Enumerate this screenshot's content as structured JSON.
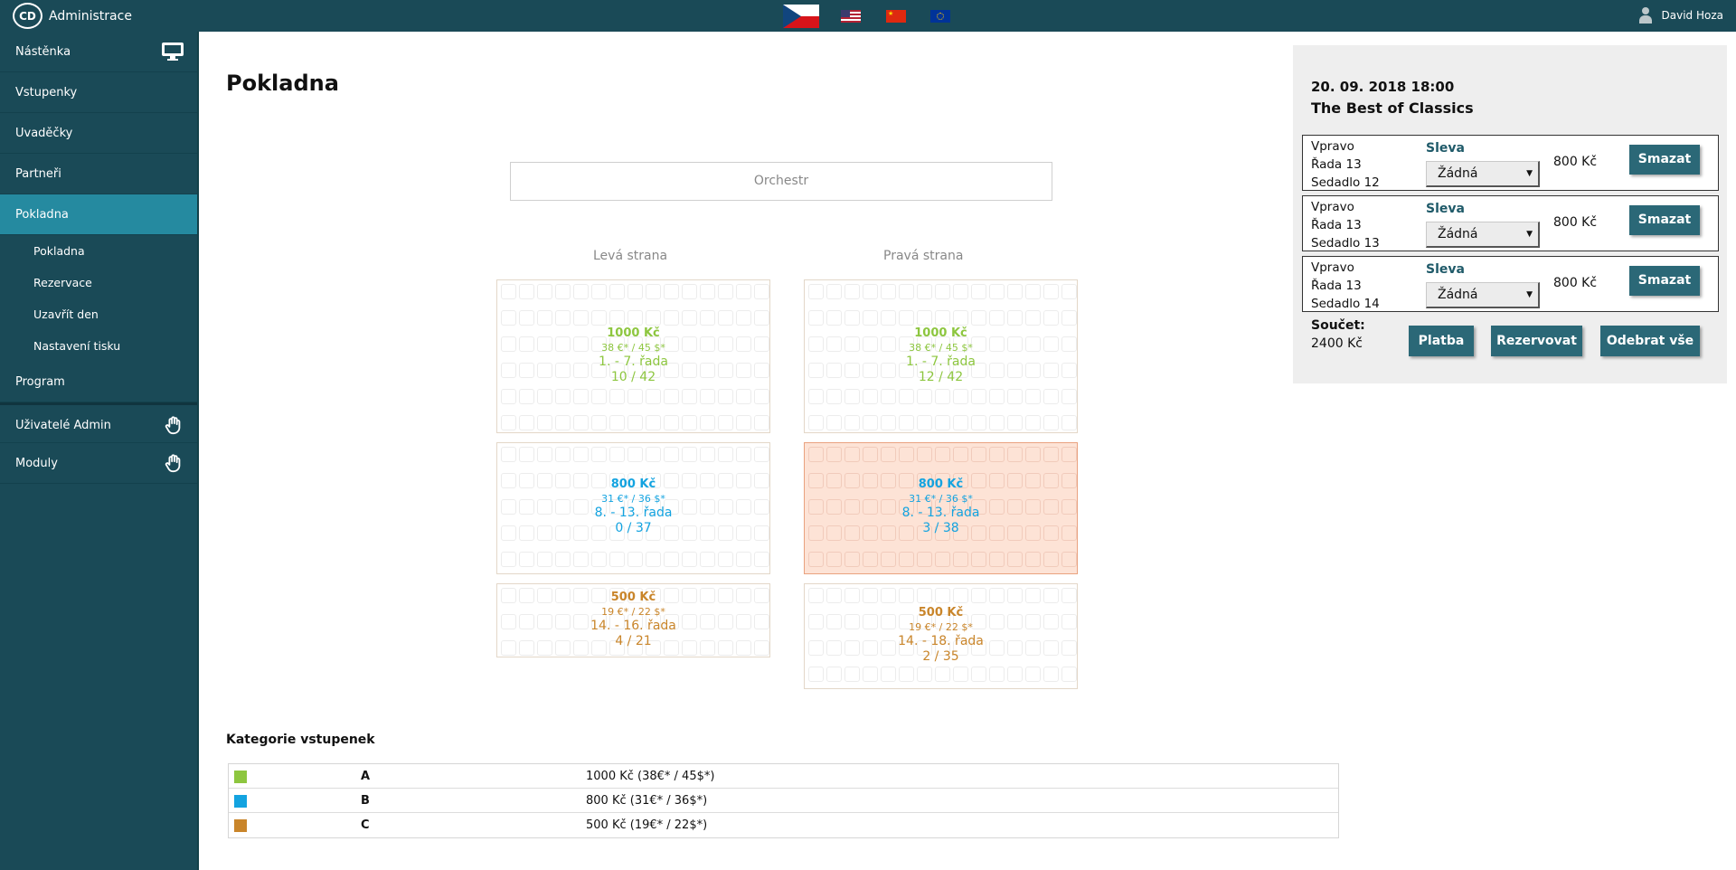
{
  "header": {
    "logo_text": "CD",
    "app_title": "Administrace",
    "user_name": "David Hoza"
  },
  "flags": [
    "cz-flag-icon",
    "us-flag-icon",
    "cn-flag-icon",
    "eu-flag-icon"
  ],
  "sidebar": {
    "items": [
      {
        "label": "Nástěnka",
        "icon": "monitor-icon"
      },
      {
        "label": "Vstupenky"
      },
      {
        "label": "Uvaděčky"
      },
      {
        "label": "Partneři"
      },
      {
        "label": "Pokladna",
        "active": true
      }
    ],
    "sub_items": [
      {
        "label": "Pokladna"
      },
      {
        "label": "Rezervace"
      },
      {
        "label": "Uzavřít den"
      },
      {
        "label": "Nastavení tisku"
      }
    ],
    "program": "Program",
    "bottom_items": [
      {
        "label": "Uživatelé Admin",
        "icon": "hand-icon"
      },
      {
        "label": "Moduly",
        "icon": "hand-icon"
      }
    ]
  },
  "main": {
    "title": "Pokladna",
    "stage_label": "Orchestr",
    "left_side_label": "Levá strana",
    "right_side_label": "Pravá strana",
    "blocks": [
      {
        "side": "left",
        "cat": "A",
        "price": "1000 Kč",
        "fx": "38 €* / 45 $*",
        "rows": "1. - 7. řada",
        "count": "10 / 42"
      },
      {
        "side": "right",
        "cat": "A",
        "price": "1000 Kč",
        "fx": "38 €* / 45 $*",
        "rows": "1. - 7. řada",
        "count": "12 / 42"
      },
      {
        "side": "left",
        "cat": "B",
        "price": "800 Kč",
        "fx": "31 €* / 36 $*",
        "rows": "8. - 13. řada",
        "count": "0 / 37"
      },
      {
        "side": "right",
        "cat": "B",
        "price": "800 Kč",
        "fx": "31 €* / 36 $*",
        "rows": "8. - 13. řada",
        "count": "3 / 38",
        "selected": true
      },
      {
        "side": "left",
        "cat": "C",
        "price": "500 Kč",
        "fx": "19 €* / 22 $*",
        "rows": "14. - 16. řada",
        "count": "4 / 21"
      },
      {
        "side": "right",
        "cat": "C",
        "price": "500 Kč",
        "fx": "19 €* / 22 $*",
        "rows": "14. - 18. řada",
        "count": "2 / 35"
      }
    ]
  },
  "legend": {
    "title": "Kategorie vstupenek",
    "rows": [
      {
        "code": "A",
        "price": "1000 Kč (38€* / 45$*)",
        "color": "#8dc63f"
      },
      {
        "code": "B",
        "price": "800 Kč (31€* / 36$*)",
        "color": "#13a3e0"
      },
      {
        "code": "C",
        "price": "500 Kč (19€* / 22$*)",
        "color": "#c9852a"
      }
    ]
  },
  "cart": {
    "date": "20. 09. 2018 18:00",
    "event": "The Best of Classics",
    "items": [
      {
        "side": "Vpravo",
        "row": "Řada 13",
        "seat": "Sedadlo 12",
        "discount_label": "Sleva",
        "discount_value": "Žádná",
        "price": "800 Kč",
        "delete_label": "Smazat"
      },
      {
        "side": "Vpravo",
        "row": "Řada 13",
        "seat": "Sedadlo 13",
        "discount_label": "Sleva",
        "discount_value": "Žádná",
        "price": "800 Kč",
        "delete_label": "Smazat"
      },
      {
        "side": "Vpravo",
        "row": "Řada 13",
        "seat": "Sedadlo 14",
        "discount_label": "Sleva",
        "discount_value": "Žádná",
        "price": "800 Kč",
        "delete_label": "Smazat"
      }
    ],
    "total_label": "Součet:",
    "total_value": "2400 Kč",
    "pay_label": "Platba",
    "reserve_label": "Rezervovat",
    "remove_all_label": "Odebrat vše"
  },
  "category_colors": {
    "A": "#8dc63f",
    "B": "#13a3e0",
    "C": "#c9852a"
  }
}
